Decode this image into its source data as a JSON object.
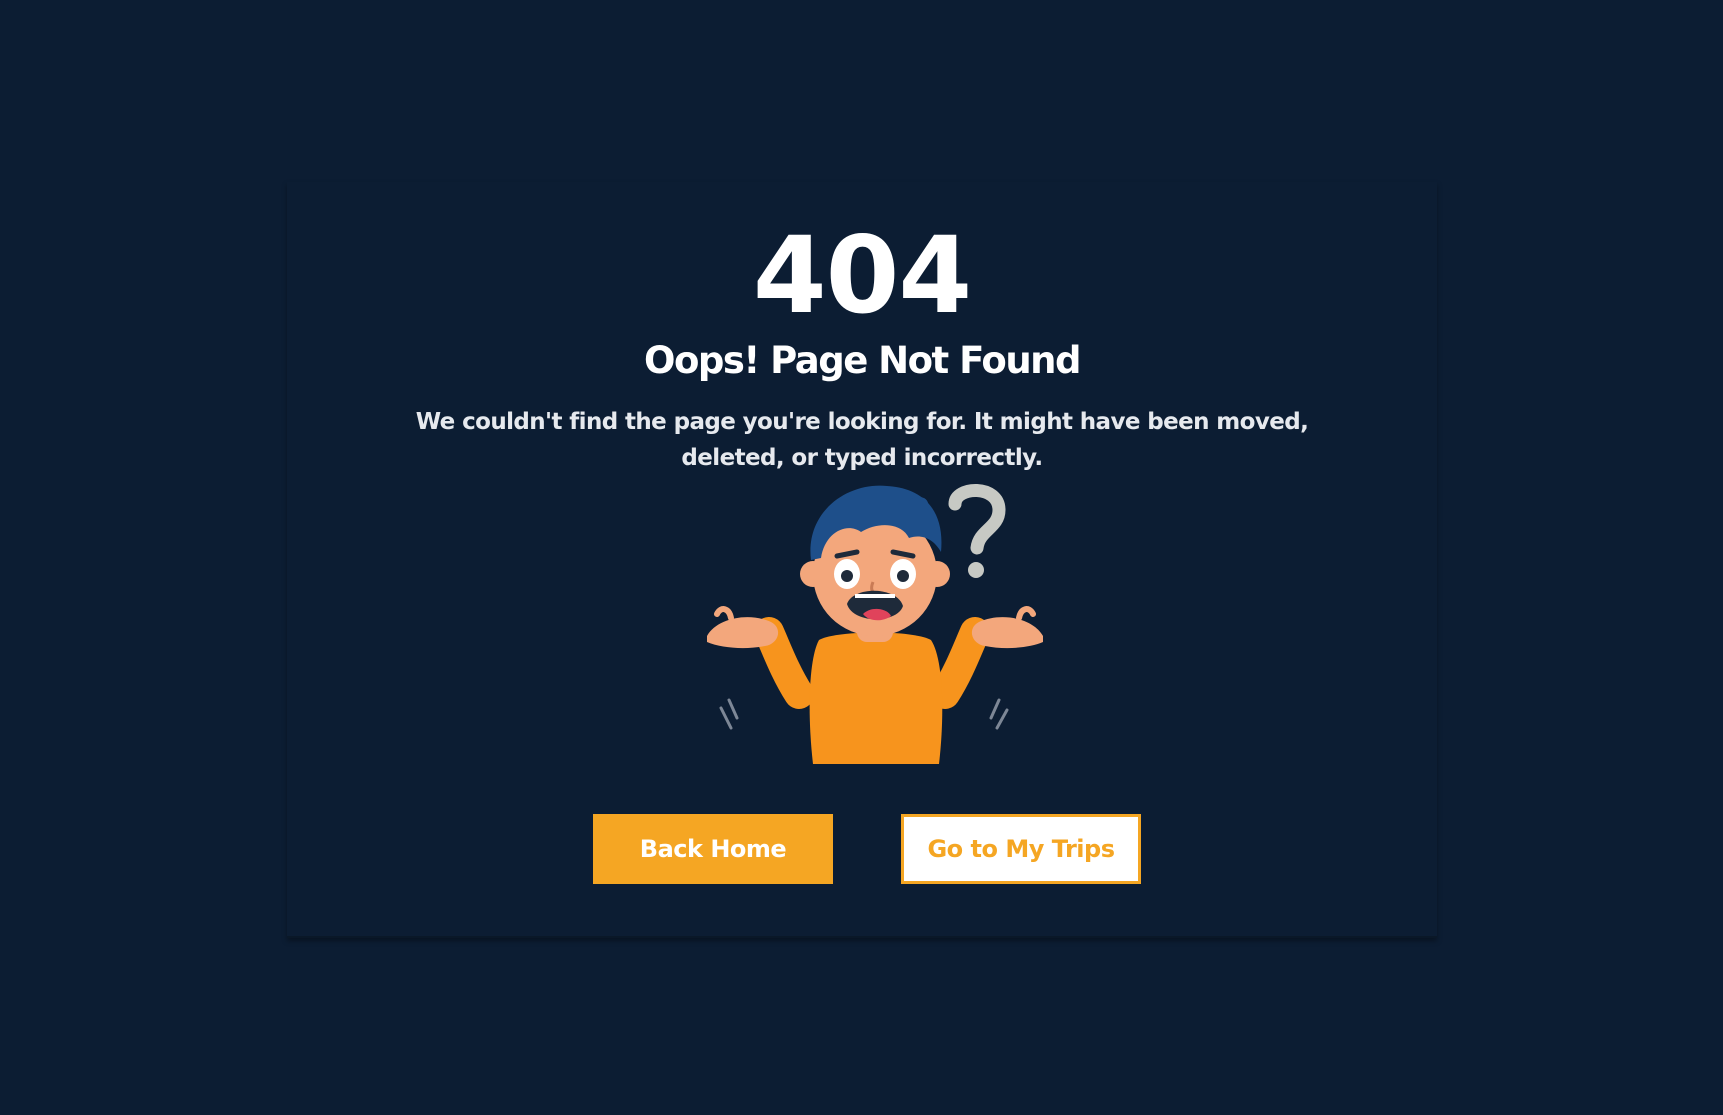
{
  "error": {
    "code": "404",
    "title": "Oops! Page Not Found",
    "message": "We couldn't find the page you're looking for. It might have been moved, deleted, or typed incorrectly."
  },
  "illustration": {
    "icon": "confused-person-question-mark"
  },
  "actions": {
    "back_home_label": "Back Home",
    "my_trips_label": "Go to My Trips"
  },
  "colors": {
    "background": "#0c1d33",
    "accent": "#f5a623",
    "text": "#ffffff"
  }
}
